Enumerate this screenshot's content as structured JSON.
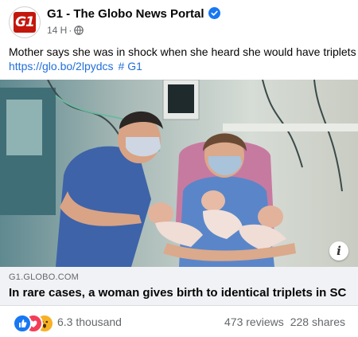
{
  "post": {
    "page_name": "G1 - The Globo News Portal",
    "logo_text": "G1",
    "time": "14 H",
    "separator": "·",
    "caption": "Mother says she was in shock when she heard she would have triplets",
    "link_text": "https://glo.bo/2lpydcs",
    "hashtag": "# G1"
  },
  "preview": {
    "domain": "G1.GLOBO.COM",
    "headline": "In rare cases, a woman gives birth to identical triplets in SC",
    "info_label": "i"
  },
  "engagement": {
    "reaction_count": "6.3 thousand",
    "reviews": "473 reviews",
    "shares": "228 shares"
  },
  "icons": {
    "verified": "verified-badge-icon",
    "privacy": "globe-icon",
    "reactions": [
      "like-reaction-icon",
      "love-reaction-icon",
      "wow-reaction-icon"
    ]
  },
  "colors": {
    "brand_red": "#c4170c",
    "link_blue": "#216fdb",
    "verified_blue": "#1877f2",
    "preview_bg": "#f0f2f5",
    "muted_text": "#65676b"
  }
}
